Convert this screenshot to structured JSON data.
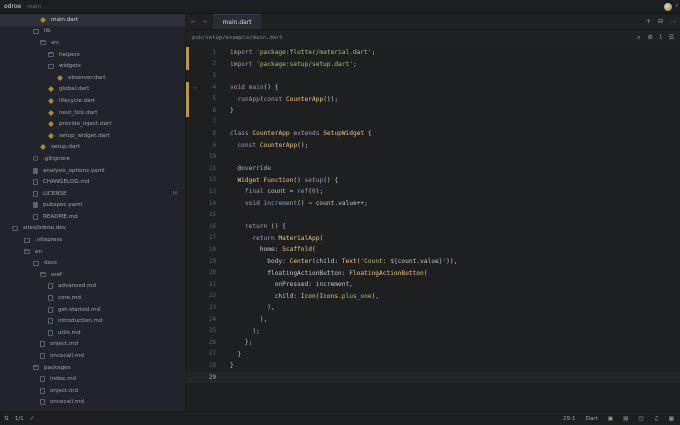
{
  "titlebar": {
    "app": "odroe",
    "branch": "main"
  },
  "sidebar": {
    "items": [
      {
        "label": "main.dart",
        "indent": 40,
        "icon": "dart",
        "selected": true
      },
      {
        "label": "lib",
        "indent": 33,
        "icon": "folder"
      },
      {
        "label": "src",
        "indent": 40,
        "icon": "folder"
      },
      {
        "label": "helpers",
        "indent": 48,
        "icon": "folder"
      },
      {
        "label": "widgets",
        "indent": 48,
        "icon": "folder"
      },
      {
        "label": "observer.dart",
        "indent": 57,
        "icon": "dart"
      },
      {
        "label": "global.dart",
        "indent": 48,
        "icon": "dart"
      },
      {
        "label": "lifecycle.dart",
        "indent": 48,
        "icon": "dart"
      },
      {
        "label": "next_tick.dart",
        "indent": 48,
        "icon": "dart"
      },
      {
        "label": "provide_inject.dart",
        "indent": 48,
        "icon": "dart"
      },
      {
        "label": "setup_widget.dart",
        "indent": 48,
        "icon": "dart"
      },
      {
        "label": "setup.dart",
        "indent": 40,
        "icon": "dart"
      },
      {
        "label": ".gitignore",
        "indent": 33,
        "icon": "git"
      },
      {
        "label": "analysis_options.yaml",
        "indent": 33,
        "icon": "yaml"
      },
      {
        "label": "CHANGELOG.md",
        "indent": 33,
        "icon": "file"
      },
      {
        "label": "LICENSE",
        "indent": 33,
        "icon": "file",
        "badge": "M"
      },
      {
        "label": "pubspec.yaml",
        "indent": 33,
        "icon": "yaml"
      },
      {
        "label": "README.md",
        "indent": 33,
        "icon": "file"
      },
      {
        "label": "sites/odroe.dev",
        "indent": 12,
        "icon": "folder"
      },
      {
        "label": ".vitepress",
        "indent": 24,
        "icon": "folder"
      },
      {
        "label": "en",
        "indent": 24,
        "icon": "folder"
      },
      {
        "label": "docs",
        "indent": 33,
        "icon": "folder"
      },
      {
        "label": "oref",
        "indent": 40,
        "icon": "folder"
      },
      {
        "label": "advanced.md",
        "indent": 48,
        "icon": "file"
      },
      {
        "label": "core.md",
        "indent": 48,
        "icon": "file"
      },
      {
        "label": "get-started.md",
        "indent": 48,
        "icon": "file"
      },
      {
        "label": "introduction.md",
        "indent": 48,
        "icon": "file"
      },
      {
        "label": "utils.md",
        "indent": 48,
        "icon": "file"
      },
      {
        "label": "onject.md",
        "indent": 40,
        "icon": "file"
      },
      {
        "label": "oncecall.md",
        "indent": 40,
        "icon": "file"
      },
      {
        "label": "packages",
        "indent": 33,
        "icon": "folder"
      },
      {
        "label": "index.md",
        "indent": 40,
        "icon": "file"
      },
      {
        "label": "onject.md",
        "indent": 40,
        "icon": "file"
      },
      {
        "label": "oncecall.md",
        "indent": 40,
        "icon": "file"
      }
    ]
  },
  "tabbar": {
    "back": "←",
    "forward": "→",
    "active_tab": "main.dart",
    "add": "+",
    "split": "⊟",
    "more": "⋯"
  },
  "breadcrumb": {
    "path": "pub/setup/example/main.dart"
  },
  "editor": {
    "current_line": 29,
    "lines": [
      {
        "n": "1",
        "html": "<span class=\"kw\">import</span> <span class=\"str\">'package:flutter/material.dart'</span>;",
        "mod": true
      },
      {
        "n": "2",
        "html": "<span class=\"kw\">import</span> <span class=\"str\">'package:setup/setup.dart'</span>;",
        "mod": true
      },
      {
        "n": "3",
        "html": ""
      },
      {
        "n": "4",
        "html": "<span class=\"kw\">void</span> <span class=\"fn\">main</span>() {",
        "mod": true,
        "fold": true
      },
      {
        "n": "5",
        "html": "  <span class=\"fn\">runApp</span>(<span class=\"kw\">const</span> <span class=\"ty\">CounterApp</span>());",
        "mod": true
      },
      {
        "n": "6",
        "html": "}",
        "mod": true
      },
      {
        "n": "7",
        "html": ""
      },
      {
        "n": "8",
        "html": "<span class=\"kw\">class</span> <span class=\"ty\">CounterApp</span> <span class=\"kw\">extends</span> <span class=\"ty\">SetupWidget</span> {"
      },
      {
        "n": "9",
        "html": "  <span class=\"kw\">const</span> <span class=\"ty\">CounterApp</span>();"
      },
      {
        "n": "10",
        "html": ""
      },
      {
        "n": "11",
        "html": "  <span class=\"an\">@override</span>"
      },
      {
        "n": "12",
        "html": "  <span class=\"ty\">Widget</span> <span class=\"ty\">Function</span>() <span class=\"fn\">setup</span>() {"
      },
      {
        "n": "13",
        "html": "    <span class=\"kw\">final</span> count = <span class=\"fn\">ref</span>(<span class=\"num\">0</span>);"
      },
      {
        "n": "14",
        "html": "    <span class=\"kw\">void</span> <span class=\"fn\">increment</span>() ⇒ count.value++;"
      },
      {
        "n": "15",
        "html": ""
      },
      {
        "n": "16",
        "html": "    <span class=\"kw\">return</span> () {"
      },
      {
        "n": "17",
        "html": "      <span class=\"kw\">return</span> <span class=\"ty\">MaterialApp</span>("
      },
      {
        "n": "18",
        "html": "        home: <span class=\"ty\">Scaffold</span>("
      },
      {
        "n": "19",
        "html": "          body: <span class=\"ty\">Center</span>(child: <span class=\"ty\">Text</span>(<span class=\"str\">'Count: </span><span class=\"an\">${</span>count.value<span class=\"an\">}</span><span class=\"str\">'</span>)),"
      },
      {
        "n": "20",
        "html": "          floatingActionButton: <span class=\"ty\">FloatingActionButton</span>("
      },
      {
        "n": "21",
        "html": "            onPressed: increment,"
      },
      {
        "n": "22",
        "html": "            child: <span class=\"ty\">Icon</span>(<span class=\"ty\">Icons</span>.<span class=\"str\">plus_one</span>),"
      },
      {
        "n": "23",
        "html": "          ),"
      },
      {
        "n": "24",
        "html": "        ),"
      },
      {
        "n": "25",
        "html": "      );"
      },
      {
        "n": "26",
        "html": "    };"
      },
      {
        "n": "27",
        "html": "  }"
      },
      {
        "n": "28",
        "html": "}"
      },
      {
        "n": "29",
        "html": ""
      }
    ]
  },
  "statusbar": {
    "branch_icon": "⇅",
    "branch_count": "1/1",
    "check": "✓",
    "cursor": "29:1",
    "language": "Dart",
    "colors": {
      "modified": "#b99a43"
    }
  }
}
